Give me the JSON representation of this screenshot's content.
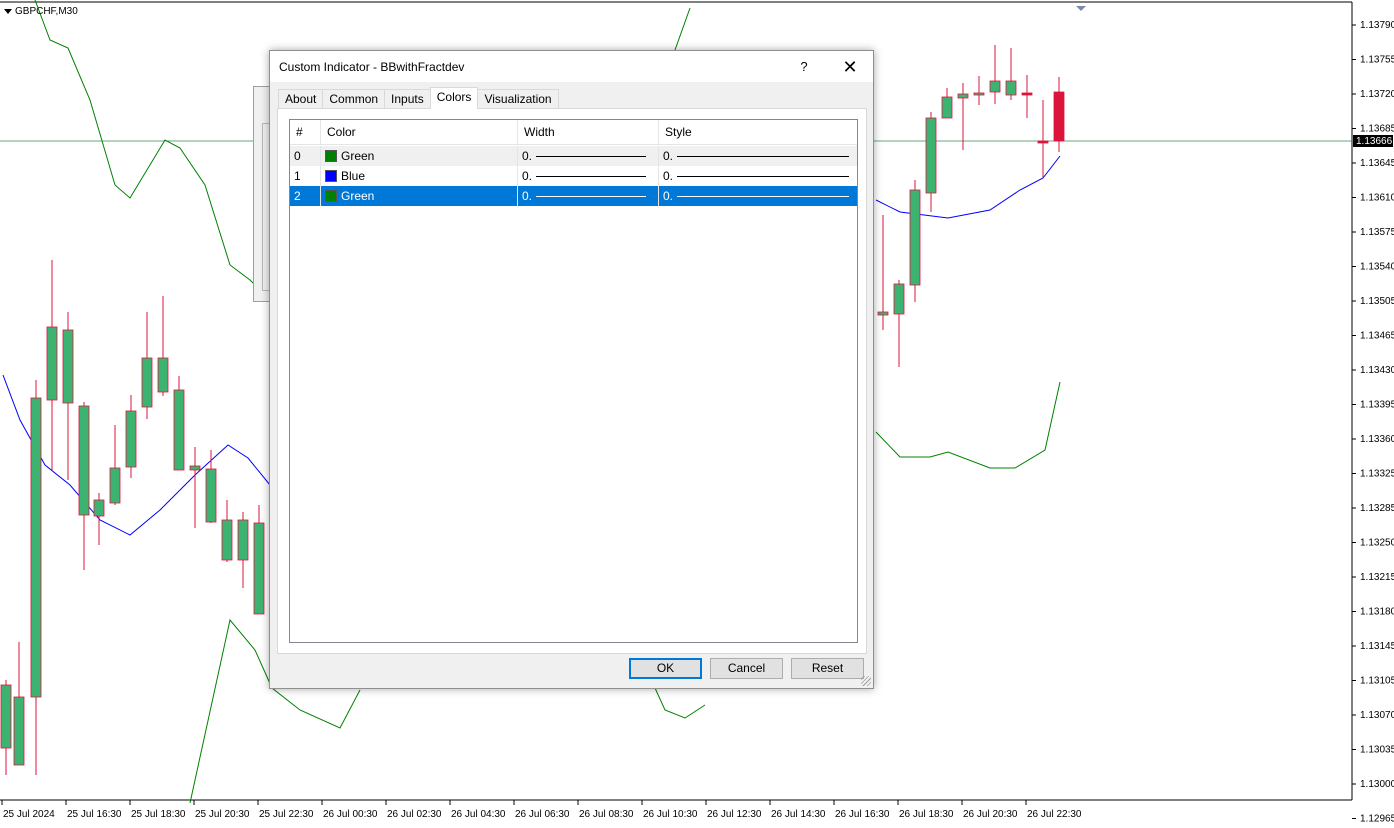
{
  "chart": {
    "symbol": "GBPCHF,M30",
    "current_price": "1.13666",
    "price_axis": [
      "1.13790",
      "1.13755",
      "1.13720",
      "1.13685",
      "1.13645",
      "1.13610",
      "1.13575",
      "1.13540",
      "1.13505",
      "1.13465",
      "1.13430",
      "1.13395",
      "1.13360",
      "1.13325",
      "1.13285",
      "1.13250",
      "1.13215",
      "1.13180",
      "1.13145",
      "1.13105",
      "1.13070",
      "1.13035",
      "1.13000",
      "1.12965"
    ],
    "time_axis": [
      "25 Jul 2024",
      "25 Jul 16:30",
      "25 Jul 18:30",
      "25 Jul 20:30",
      "25 Jul 22:30",
      "26 Jul 00:30",
      "26 Jul 02:30",
      "26 Jul 04:30",
      "26 Jul 06:30",
      "26 Jul 08:30",
      "26 Jul 10:30",
      "26 Jul 12:30",
      "26 Jul 14:30",
      "26 Jul 16:30",
      "26 Jul 18:30",
      "26 Jul 20:30",
      "26 Jul 22:30"
    ],
    "colors": {
      "bull": "#3cb371",
      "bear": "#dc143c",
      "upper_band": "#008000",
      "mid_band": "#0000ff",
      "price_line": "#2e8b57"
    }
  },
  "dialog": {
    "title": "Custom Indicator - BBwithFractdev",
    "help_label": "?",
    "close_label": "✕",
    "tabs": [
      "About",
      "Common",
      "Inputs",
      "Colors",
      "Visualization"
    ],
    "active_tab": "Colors",
    "columns": [
      "#",
      "Color",
      "Width",
      "Style"
    ],
    "rows": [
      {
        "index": "0",
        "color_name": "Green",
        "color_hex": "#008000",
        "width": "0.",
        "style": "0."
      },
      {
        "index": "1",
        "color_name": "Blue",
        "color_hex": "#0000ff",
        "width": "0.",
        "style": "0."
      },
      {
        "index": "2",
        "color_name": "Green",
        "color_hex": "#008000",
        "width": "0.",
        "style": "0."
      }
    ],
    "buttons": {
      "ok": "OK",
      "cancel": "Cancel",
      "reset": "Reset"
    }
  }
}
